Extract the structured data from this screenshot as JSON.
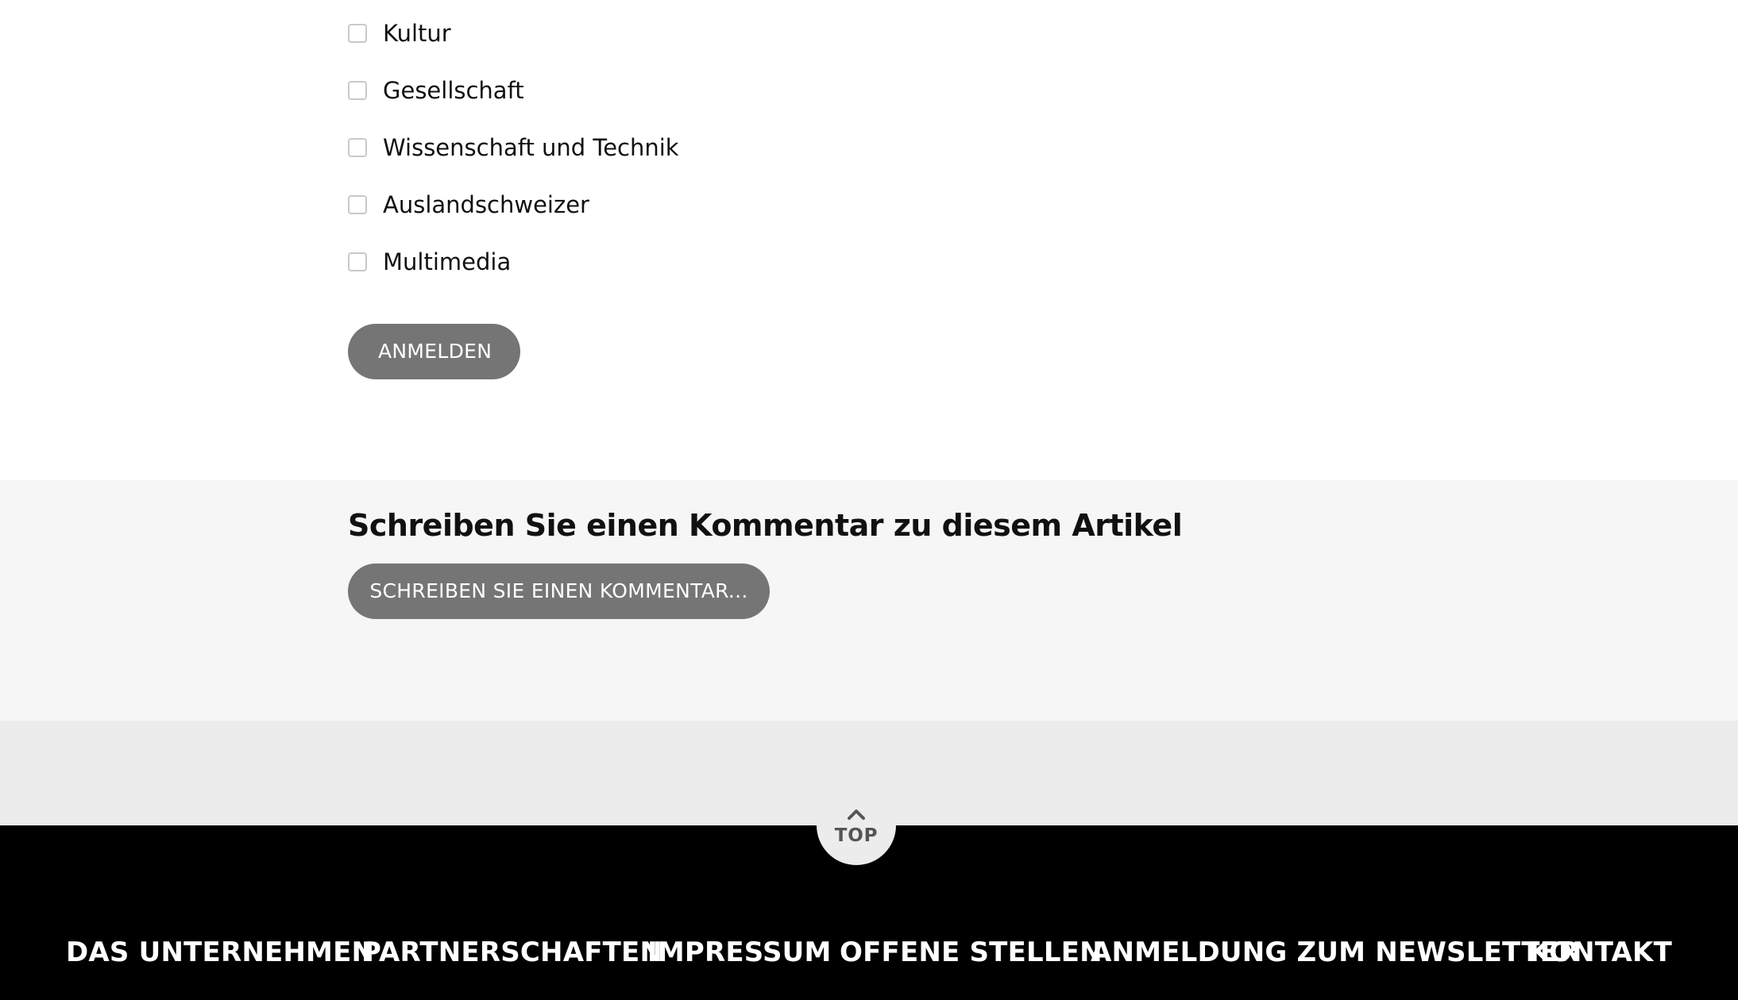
{
  "newsletter": {
    "topics": [
      {
        "label": "Kultur",
        "checked": false
      },
      {
        "label": "Gesellschaft",
        "checked": false
      },
      {
        "label": "Wissenschaft und Technik",
        "checked": false
      },
      {
        "label": "Auslandschweizer",
        "checked": false
      },
      {
        "label": "Multimedia",
        "checked": false
      }
    ],
    "subscribe_label": "ANMELDEN"
  },
  "comments": {
    "heading": "Schreiben Sie einen Kommentar zu diesem Artikel",
    "write_button_label": "SCHREIBEN SIE EINEN KOMMENTAR..."
  },
  "back_to_top": {
    "icon": "chevron-up-icon",
    "label": "TOP"
  },
  "footer": {
    "links": [
      "DAS UNTERNEHMEN",
      "PARTNERSCHAFTEN",
      "IMPRESSUM",
      "OFFENE STELLEN",
      "ANMELDUNG ZUM NEWSLETTER",
      "KONTAKT"
    ]
  },
  "colors": {
    "button_bg": "#757575",
    "comment_bg": "#f6f6f6",
    "band_bg": "#ececec",
    "footer_bg": "#000000"
  }
}
